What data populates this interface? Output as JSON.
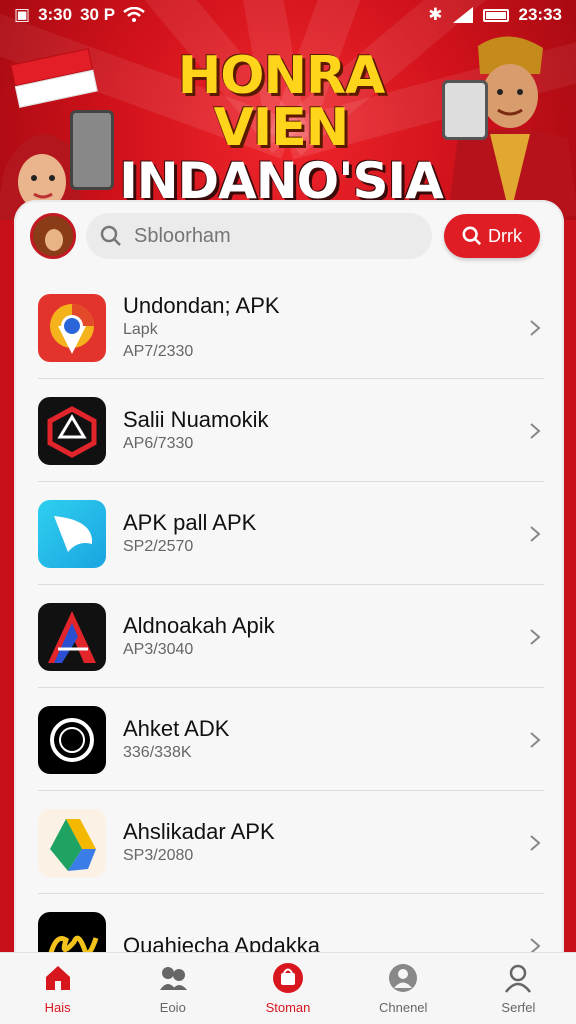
{
  "status_bar": {
    "left_text": "30 P",
    "left_time": "3:30",
    "right_time": "23:33"
  },
  "banner": {
    "title_line1": "HONRA VIEN",
    "title_line2": "INDANO'SIA"
  },
  "search": {
    "placeholder": "Sbloorham",
    "button_label": "Drrk"
  },
  "apps": [
    {
      "name": "Undondan; APK",
      "sub": "Lapk",
      "version": "AP7/2330",
      "icon": "chrome-pin-icon"
    },
    {
      "name": "Salii Nuamokik",
      "sub": "",
      "version": "AP6/7330",
      "icon": "red-cube-icon"
    },
    {
      "name": "APK pall APK",
      "sub": "",
      "version": "SP2/2570",
      "icon": "blue-arrow-icon"
    },
    {
      "name": "Aldnoakah Apik",
      "sub": "",
      "version": "AP3/3040",
      "icon": "red-a-icon"
    },
    {
      "name": "Ahket ADK",
      "sub": "",
      "version": "336/338K",
      "icon": "black-circle-icon"
    },
    {
      "name": "Ahslikadar APK",
      "sub": "",
      "version": "SP3/2080",
      "icon": "drive-triangle-icon"
    },
    {
      "name": "Ouahiecha Apdakka",
      "sub": "",
      "version": "",
      "icon": "gold-script-icon"
    }
  ],
  "nav": [
    {
      "label": "Hais",
      "icon": "home-icon",
      "active": true
    },
    {
      "label": "Eoio",
      "icon": "people-icon",
      "active": false
    },
    {
      "label": "Stoman",
      "icon": "store-icon",
      "active": false
    },
    {
      "label": "Chnenel",
      "icon": "user-circle-icon",
      "active": false
    },
    {
      "label": "Serfel",
      "icon": "profile-icon",
      "active": false
    }
  ],
  "colors": {
    "brand_red": "#e01d25",
    "banner_red": "#d1121b",
    "title_yellow": "#ffd51c"
  }
}
